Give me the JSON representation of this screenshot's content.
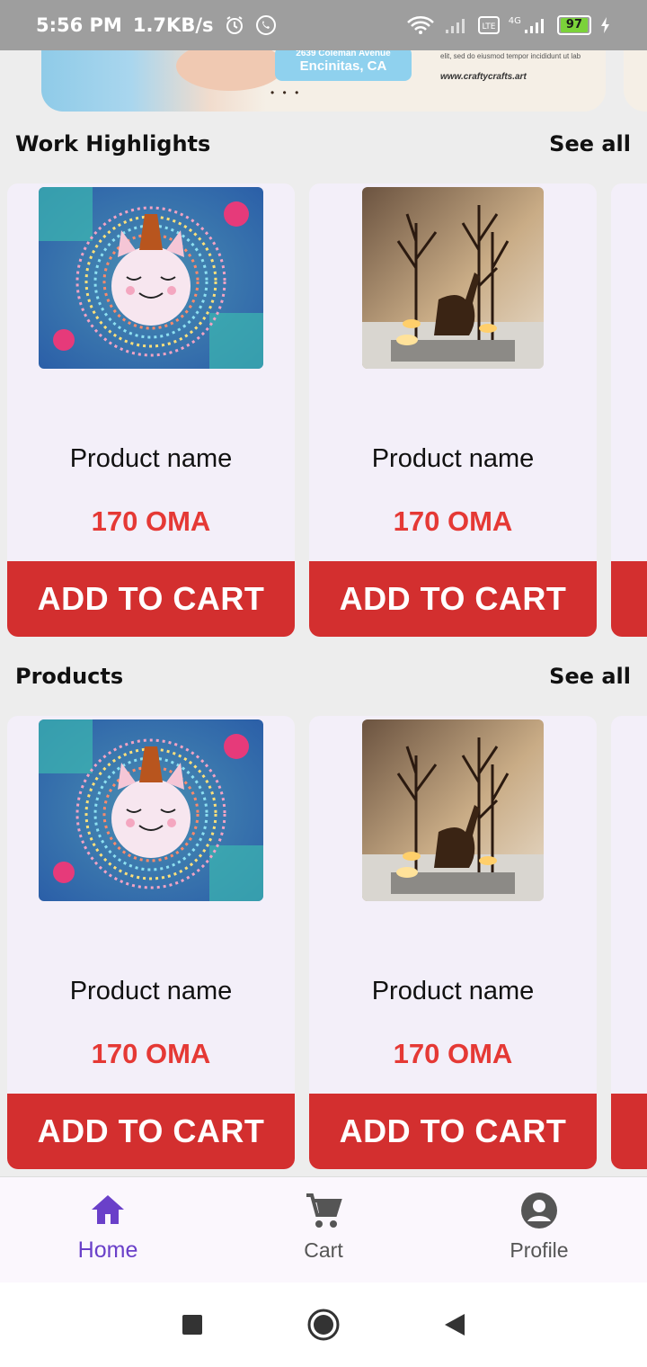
{
  "status_bar": {
    "time": "5:56 PM",
    "speed": "1.7KB/s",
    "network_tag": "4G",
    "battery": "97"
  },
  "banner": {
    "address": "2639 Coleman Avenue",
    "city": "Encinitas, CA",
    "body_text": "elit, sed do eiusmod tempor incididunt ut lab",
    "url": "www.craftycrafts.art"
  },
  "sections": [
    {
      "title": "Work Highlights",
      "see_all": "See all",
      "cards": [
        {
          "name": "Product name",
          "price": "170 OMA",
          "button": "ADD TO CART",
          "image": "unicode-yarn-craft"
        },
        {
          "name": "Product name",
          "price": "170 OMA",
          "button": "ADD TO CART",
          "image": "deer-candle-holder"
        }
      ]
    },
    {
      "title": "Products",
      "see_all": "See all",
      "cards": [
        {
          "name": "Product name",
          "price": "170 OMA",
          "button": "ADD TO CART",
          "image": "unicode-yarn-craft"
        },
        {
          "name": "Product name",
          "price": "170 OMA",
          "button": "ADD TO CART",
          "image": "deer-candle-holder"
        }
      ]
    }
  ],
  "bottom_nav": {
    "items": [
      {
        "label": "Home",
        "icon": "home-icon",
        "active": true
      },
      {
        "label": "Cart",
        "icon": "cart-icon",
        "active": false
      },
      {
        "label": "Profile",
        "icon": "profile-icon",
        "active": false
      }
    ]
  },
  "colors": {
    "accent_red": "#d32f2f",
    "price_red": "#e53935",
    "active_nav": "#6a40c9"
  }
}
